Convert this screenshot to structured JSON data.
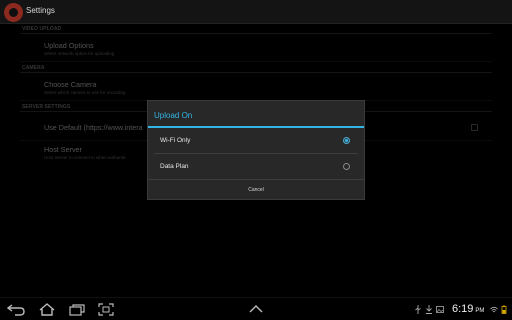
{
  "actionbar": {
    "title": "Settings",
    "icon": "app-logo-icon"
  },
  "sections": [
    {
      "header": "VIDEO UPLOAD"
    },
    {
      "header": "CAMERA"
    },
    {
      "header": "SERVER SETTINGS"
    }
  ],
  "prefs": [
    {
      "title": "Upload Options",
      "summary": "Select network option for uploading"
    },
    {
      "title": "Choose Camera",
      "summary": "Select which camera to use for recording"
    },
    {
      "title": "Use Default (https://www.intera",
      "summary": "",
      "checked": false
    },
    {
      "title": "Host Server",
      "summary": "Host Server to connect to when authentic"
    }
  ],
  "dialog": {
    "title": "Upload On",
    "options": [
      {
        "label": "Wi-Fi Only",
        "selected": true
      },
      {
        "label": "Data Plan",
        "selected": false
      }
    ],
    "cancel_label": "Cancel"
  },
  "navbar": {
    "buttons": [
      "back-icon",
      "home-icon",
      "recent-apps-icon",
      "screenshot-icon",
      "up-arrow-icon"
    ]
  },
  "status": {
    "time": "6:19",
    "am_pm": "PM",
    "icons": [
      "usb-icon",
      "download-icon",
      "image-icon",
      "wifi-icon",
      "battery-icon"
    ]
  },
  "colors": {
    "accent": "#33b5e5",
    "background": "#000000",
    "dialog": "#282828"
  }
}
